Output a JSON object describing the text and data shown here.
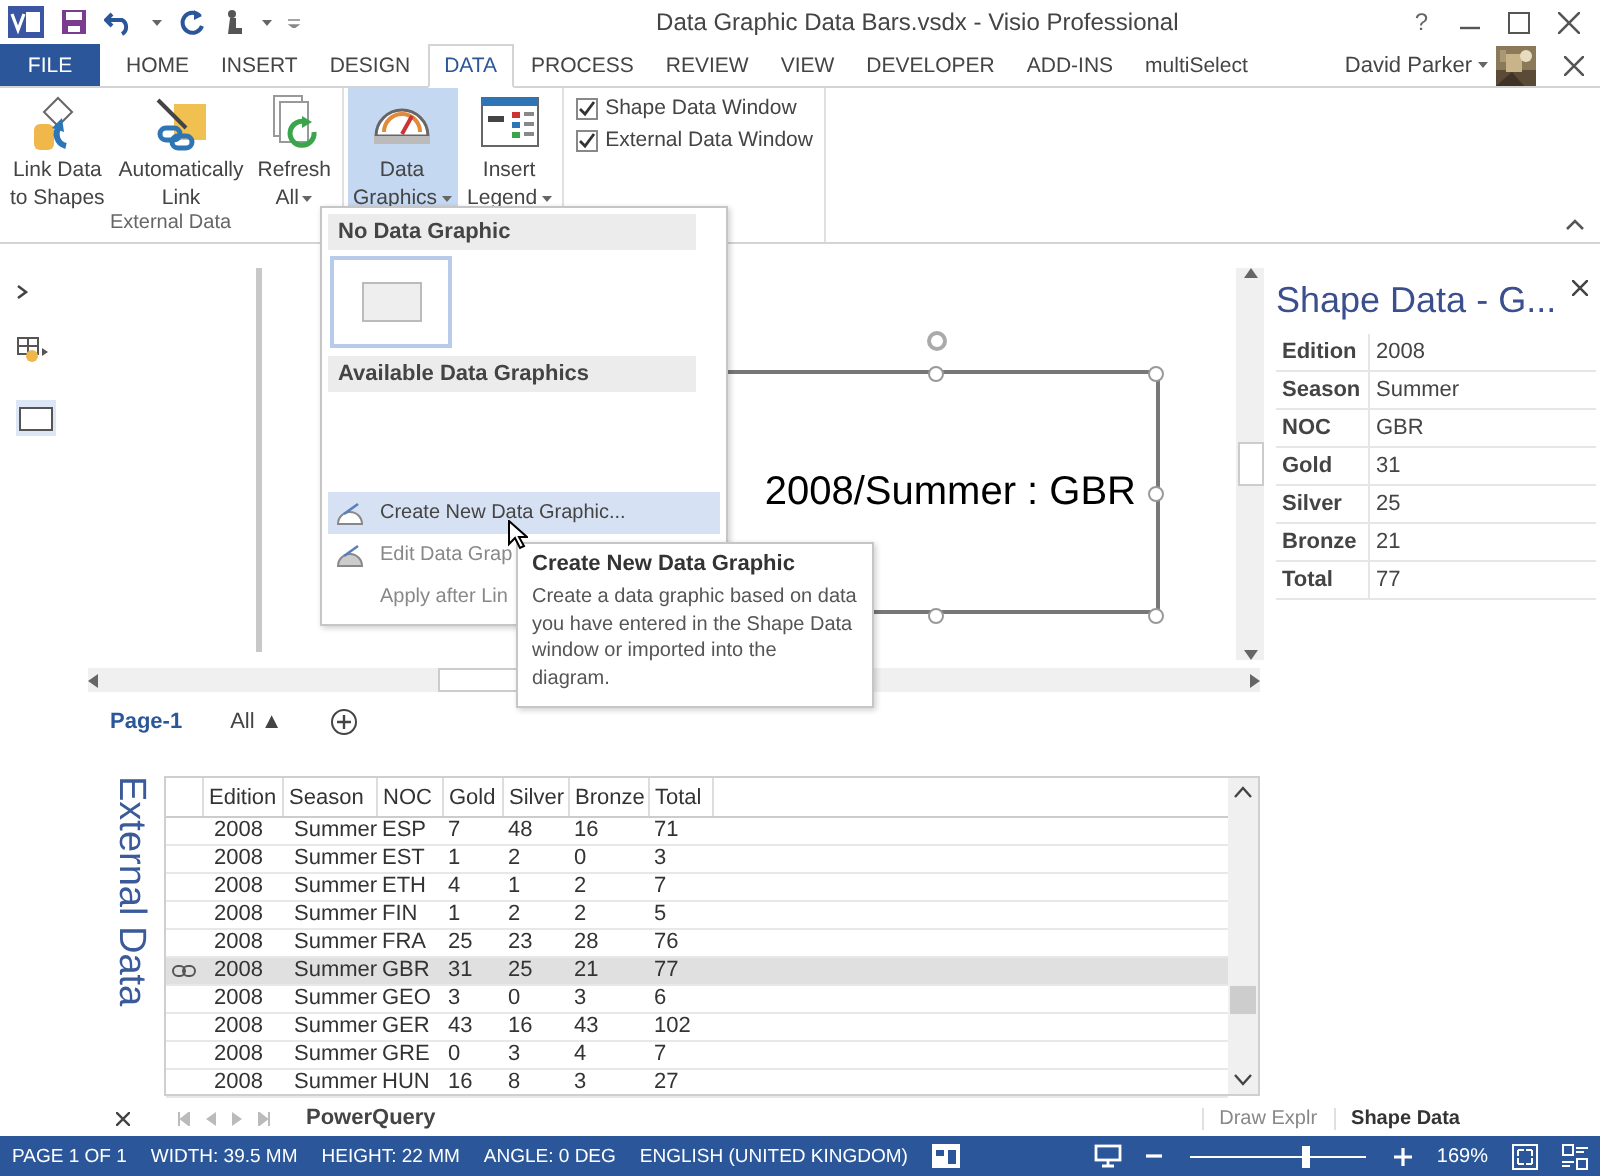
{
  "window": {
    "title": "Data Graphic Data Bars.vsdx - Visio Professional",
    "help": "?",
    "user": "David Parker"
  },
  "tabs": [
    {
      "label": "FILE",
      "kind": "file",
      "selected": false
    },
    {
      "label": "HOME",
      "kind": "tab",
      "selected": false
    },
    {
      "label": "INSERT",
      "kind": "tab",
      "selected": false
    },
    {
      "label": "DESIGN",
      "kind": "tab",
      "selected": false
    },
    {
      "label": "DATA",
      "kind": "tab",
      "selected": true
    },
    {
      "label": "PROCESS",
      "kind": "tab",
      "selected": false
    },
    {
      "label": "REVIEW",
      "kind": "tab",
      "selected": false
    },
    {
      "label": "VIEW",
      "kind": "tab",
      "selected": false
    },
    {
      "label": "DEVELOPER",
      "kind": "tab",
      "selected": false
    },
    {
      "label": "ADD-INS",
      "kind": "tab",
      "selected": false
    },
    {
      "label": "multiSelect",
      "kind": "tab",
      "selected": false
    }
  ],
  "ribbon": {
    "group_label": "External Data",
    "buttons": [
      {
        "lines": [
          "Link Data",
          "to Shapes"
        ],
        "kind": "link",
        "dropdown": false,
        "selected": false
      },
      {
        "lines": [
          "Automatically",
          "Link"
        ],
        "kind": "autolink",
        "dropdown": false,
        "selected": false
      },
      {
        "lines": [
          "Refresh",
          "All"
        ],
        "kind": "refresh",
        "dropdown": true,
        "selected": false
      },
      {
        "lines": [
          "Data",
          "Graphics"
        ],
        "kind": "graphics",
        "dropdown": true,
        "selected": true
      },
      {
        "lines": [
          "Insert",
          "Legend"
        ],
        "kind": "legend",
        "dropdown": true,
        "selected": false
      }
    ],
    "checkboxes": [
      {
        "label": "Shape Data Window",
        "checked": true
      },
      {
        "label": "External Data Window",
        "checked": true
      }
    ]
  },
  "menu": {
    "headings": [
      "No Data Graphic",
      "Available Data Graphics"
    ],
    "items": [
      {
        "label": "Create New Data Graphic...",
        "icon": true,
        "selected": true,
        "disabled": false
      },
      {
        "label": "Edit Data Grap",
        "icon": true,
        "selected": false,
        "disabled": true
      },
      {
        "label": "Apply after Lin",
        "icon": false,
        "selected": false,
        "disabled": true
      }
    ]
  },
  "tooltip": {
    "title": "Create New Data Graphic",
    "body": "Create a data graphic based on data you have entered in the Shape Data window or imported into the diagram."
  },
  "shape": {
    "text": "2008/Summer : GBR"
  },
  "shape_data": {
    "title": "Shape Data - G...",
    "rows": [
      {
        "label": "Edition",
        "value": "2008"
      },
      {
        "label": "Season",
        "value": "Summer"
      },
      {
        "label": "NOC",
        "value": "GBR"
      },
      {
        "label": "Gold",
        "value": "31"
      },
      {
        "label": "Silver",
        "value": "25"
      },
      {
        "label": "Bronze",
        "value": "21"
      },
      {
        "label": "Total",
        "value": "77"
      }
    ]
  },
  "page_tabs": [
    {
      "label": "Page-1",
      "selected": true
    },
    {
      "label": "All ▲",
      "selected": false
    }
  ],
  "external_data": {
    "title": "External Data",
    "columns": [
      "Edition",
      "Season",
      "NOC",
      "Gold",
      "Silver",
      "Bronze",
      "Total"
    ],
    "rows": [
      {
        "cells": [
          "2008",
          "Summer",
          "ESP",
          "7",
          "48",
          "16",
          "71"
        ],
        "selected": false,
        "linked": false
      },
      {
        "cells": [
          "2008",
          "Summer",
          "EST",
          "1",
          "2",
          "0",
          "3"
        ],
        "selected": false,
        "linked": false
      },
      {
        "cells": [
          "2008",
          "Summer",
          "ETH",
          "4",
          "1",
          "2",
          "7"
        ],
        "selected": false,
        "linked": false
      },
      {
        "cells": [
          "2008",
          "Summer",
          "FIN",
          "1",
          "2",
          "2",
          "5"
        ],
        "selected": false,
        "linked": false
      },
      {
        "cells": [
          "2008",
          "Summer",
          "FRA",
          "25",
          "23",
          "28",
          "76"
        ],
        "selected": false,
        "linked": false
      },
      {
        "cells": [
          "2008",
          "Summer",
          "GBR",
          "31",
          "25",
          "21",
          "77"
        ],
        "selected": true,
        "linked": true
      },
      {
        "cells": [
          "2008",
          "Summer",
          "GEO",
          "3",
          "0",
          "3",
          "6"
        ],
        "selected": false,
        "linked": false
      },
      {
        "cells": [
          "2008",
          "Summer",
          "GER",
          "43",
          "16",
          "43",
          "102"
        ],
        "selected": false,
        "linked": false
      },
      {
        "cells": [
          "2008",
          "Summer",
          "GRE",
          "0",
          "3",
          "4",
          "7"
        ],
        "selected": false,
        "linked": false
      },
      {
        "cells": [
          "2008",
          "Summer",
          "HUN",
          "16",
          "8",
          "3",
          "27"
        ],
        "selected": false,
        "linked": false
      }
    ],
    "sheet_tabs": [
      {
        "label": "PowerQuery",
        "selected": true
      }
    ]
  },
  "panel_tabs": [
    {
      "label": "Draw Explr",
      "selected": false
    },
    {
      "label": "Shape Data",
      "selected": true
    }
  ],
  "status_bar": {
    "items": [
      "PAGE 1 OF 1",
      "WIDTH: 39.5 MM",
      "HEIGHT: 22 MM",
      "ANGLE: 0 DEG",
      "ENGLISH (UNITED KINGDOM)"
    ],
    "zoom": "169%",
    "zoom_slider": {
      "level": 0.65
    }
  }
}
